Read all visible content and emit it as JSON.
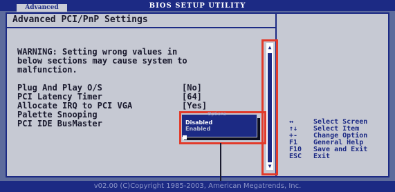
{
  "window": {
    "title": "BIOS SETUP UTILITY",
    "active_tab": "Advanced"
  },
  "panel": {
    "heading": "Advanced PCI/PnP Settings",
    "warning": [
      "WARNING: Setting wrong values in",
      "below sections may cause system to",
      "malfunction."
    ]
  },
  "settings": [
    {
      "label": "Plug And Play O/S",
      "value": "[No]"
    },
    {
      "label": "PCI Latency Timer",
      "value": "[64]"
    },
    {
      "label": "Allocate IRQ to PCI VGA",
      "value": "[Yes]"
    },
    {
      "label": "Palette Snooping",
      "value": ""
    },
    {
      "label": "PCI IDE BusMaster",
      "value": ""
    }
  ],
  "popup": {
    "title": "Options",
    "options": [
      "Disabled",
      "Enabled"
    ],
    "selected_index": 0
  },
  "help": [
    {
      "key": "↔",
      "desc": "Select Screen"
    },
    {
      "key": "↑↓",
      "desc": "Select Item"
    },
    {
      "key": "+-",
      "desc": "Change Option"
    },
    {
      "key": "F1",
      "desc": "General Help"
    },
    {
      "key": "F10",
      "desc": "Save and Exit"
    },
    {
      "key": "ESC",
      "desc": "Exit"
    }
  ],
  "footer": {
    "copyright": "v02.00 (C)Copyright 1985-2003, American Megatrends, Inc."
  },
  "colors": {
    "bios_blue": "#1c2a84",
    "panel_gray": "#c6c9d3",
    "highlight_red": "#e23a2a"
  }
}
